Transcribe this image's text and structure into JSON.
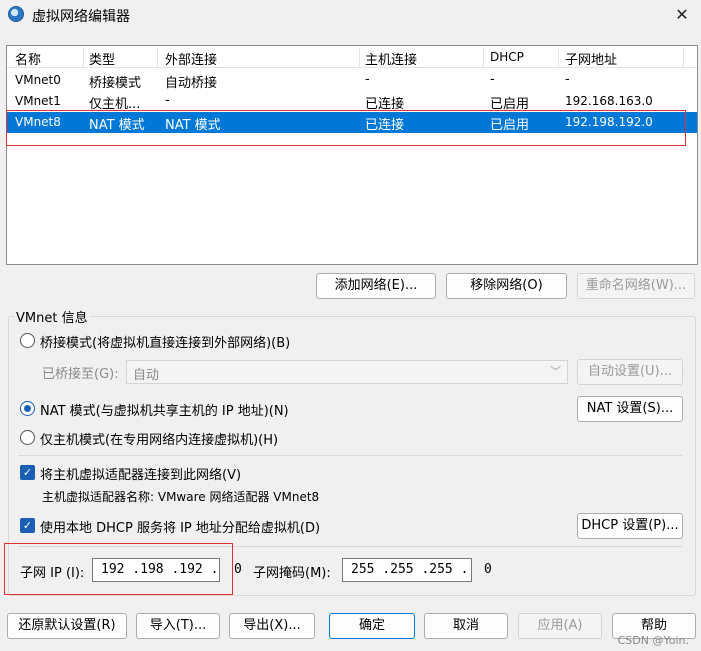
{
  "window": {
    "title": "虚拟网络编辑器",
    "close": "✕"
  },
  "table": {
    "columns": [
      "名称",
      "类型",
      "外部连接",
      "主机连接",
      "DHCP",
      "子网地址"
    ],
    "rows": [
      [
        "VMnet0",
        "桥接模式",
        "自动桥接",
        "-",
        "-",
        "-"
      ],
      [
        "VMnet1",
        "仅主机...",
        "-",
        "已连接",
        "已启用",
        "192.168.163.0"
      ],
      [
        "VMnet8",
        "NAT 模式",
        "NAT 模式",
        "已连接",
        "已启用",
        "192.198.192.0"
      ]
    ],
    "selected_index": 2
  },
  "net_buttons": {
    "add": "添加网络(E)...",
    "remove": "移除网络(O)",
    "rename": "重命名网络(W)..."
  },
  "vmnet_info": {
    "group_label": "VMnet 信息",
    "bridge_radio": "桥接模式(将虚拟机直接连接到外部网络)(B)",
    "bridged_to_label": "已桥接至(G):",
    "bridged_to_value": "自动",
    "auto_settings": "自动设置(U)...",
    "nat_radio": "NAT 模式(与虚拟机共享主机的 IP 地址)(N)",
    "nat_settings": "NAT 设置(S)...",
    "hostonly_radio": "仅主机模式(在专用网络内连接虚拟机)(H)",
    "connect_adapter_check": "将主机虚拟适配器连接到此网络(V)",
    "adapter_name": "主机虚拟适配器名称: VMware 网络适配器 VMnet8",
    "dhcp_check": "使用本地 DHCP 服务将 IP 地址分配给虚拟机(D)",
    "dhcp_settings": "DHCP 设置(P)...",
    "subnet_ip_label": "子网 IP (I):",
    "subnet_ip": "192 .198 .192 .  0",
    "subnet_mask_label": "子网掩码(M):",
    "subnet_mask": "255 .255 .255 .  0"
  },
  "footer": {
    "restore": "还原默认设置(R)",
    "import": "导入(T)...",
    "export": "导出(X)...",
    "ok": "确定",
    "cancel": "取消",
    "apply": "应用(A)",
    "help": "帮助"
  },
  "watermark": "CSDN @Yoin."
}
